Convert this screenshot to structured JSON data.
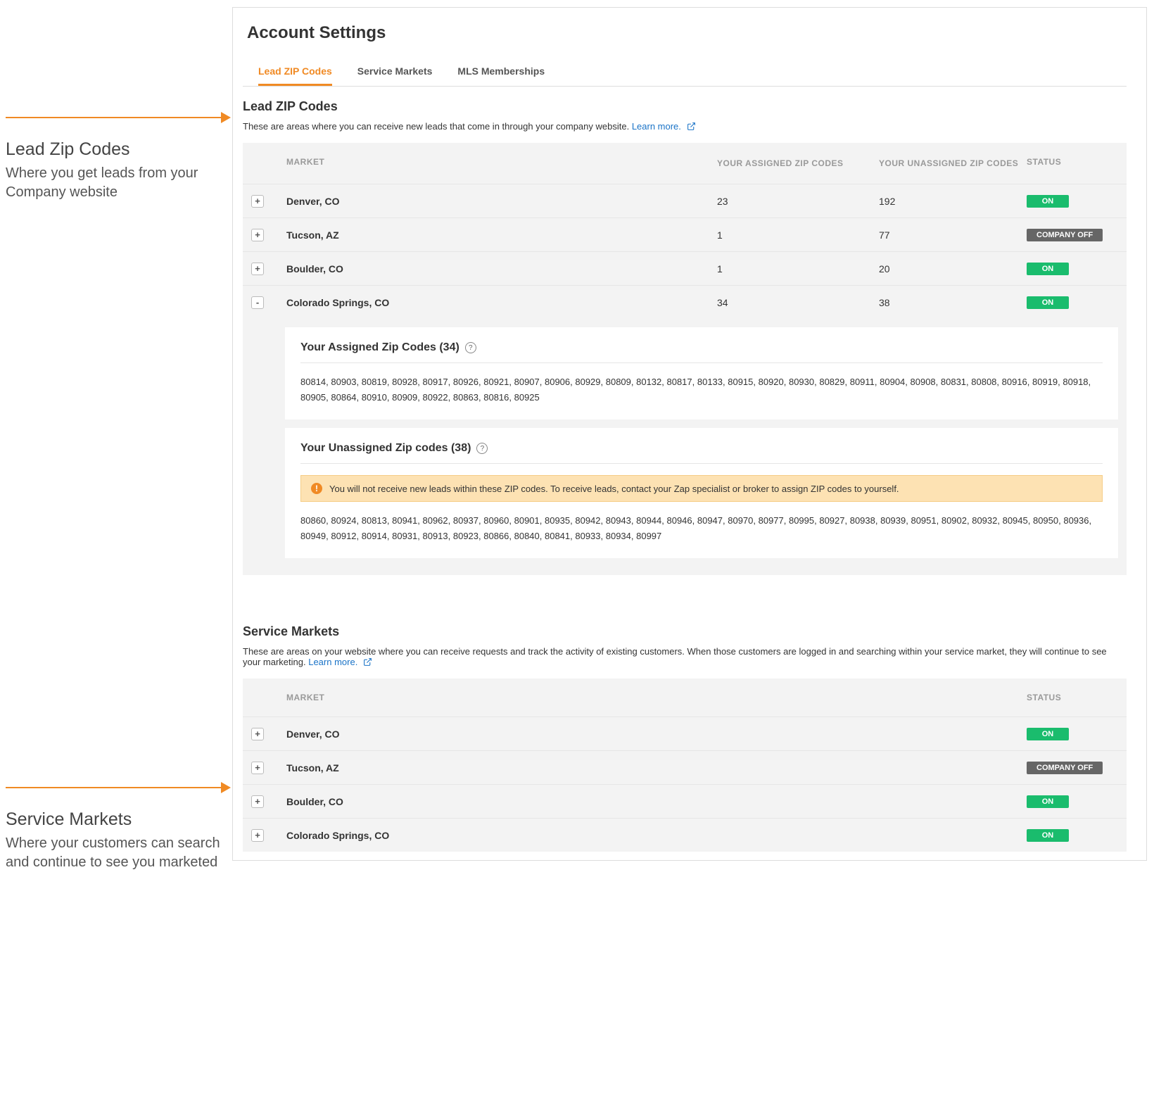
{
  "page_title": "Account Settings",
  "tabs": [
    {
      "label": "Lead ZIP Codes",
      "active": true
    },
    {
      "label": "Service Markets",
      "active": false
    },
    {
      "label": "MLS Memberships",
      "active": false
    }
  ],
  "lead_section": {
    "title": "Lead ZIP Codes",
    "description": "These are areas where you can receive new leads that come in through your company website.",
    "learn_more": "Learn more.",
    "columns": {
      "market": "MARKET",
      "assigned": "YOUR ASSIGNED ZIP CODES",
      "unassigned": "YOUR UNASSIGNED ZIP CODES",
      "status": "STATUS"
    },
    "rows": [
      {
        "market": "Denver, CO",
        "assigned": "23",
        "unassigned": "192",
        "status": "ON",
        "status_class": "on",
        "expanded": false
      },
      {
        "market": "Tucson, AZ",
        "assigned": "1",
        "unassigned": "77",
        "status": "COMPANY OFF",
        "status_class": "off",
        "expanded": false
      },
      {
        "market": "Boulder, CO",
        "assigned": "1",
        "unassigned": "20",
        "status": "ON",
        "status_class": "on",
        "expanded": false
      },
      {
        "market": "Colorado Springs, CO",
        "assigned": "34",
        "unassigned": "38",
        "status": "ON",
        "status_class": "on",
        "expanded": true
      }
    ],
    "expanded_detail": {
      "assigned_title": "Your Assigned Zip Codes (34)",
      "assigned_list": "80814, 80903, 80819, 80928, 80917, 80926, 80921, 80907, 80906, 80929, 80809, 80132, 80817, 80133, 80915, 80920, 80930, 80829, 80911, 80904, 80908, 80831, 80808, 80916, 80919, 80918, 80905, 80864, 80910, 80909, 80922, 80863, 80816, 80925",
      "unassigned_title": "Your Unassigned Zip codes (38)",
      "alert": "You will not receive new leads within these ZIP codes. To receive leads, contact your Zap specialist or broker to assign ZIP codes to yourself.",
      "unassigned_list": "80860, 80924, 80813, 80941, 80962, 80937, 80960, 80901, 80935, 80942, 80943, 80944, 80946, 80947, 80970, 80977, 80995, 80927, 80938, 80939, 80951, 80902, 80932, 80945, 80950, 80936, 80949, 80912, 80914, 80931, 80913, 80923, 80866, 80840, 80841, 80933, 80934, 80997"
    }
  },
  "service_section": {
    "title": "Service Markets",
    "description": "These are areas on your website where you can receive requests and track the activity of existing customers. When those customers are logged in and searching within your service market, they will continue to see your marketing.",
    "learn_more": "Learn more.",
    "columns": {
      "market": "MARKET",
      "status": "STATUS"
    },
    "rows": [
      {
        "market": "Denver, CO",
        "status": "ON",
        "status_class": "on"
      },
      {
        "market": "Tucson, AZ",
        "status": "COMPANY OFF",
        "status_class": "off"
      },
      {
        "market": "Boulder, CO",
        "status": "ON",
        "status_class": "on"
      },
      {
        "market": "Colorado Springs, CO",
        "status": "ON",
        "status_class": "on"
      }
    ]
  },
  "annotations": {
    "lead": {
      "title": "Lead Zip Codes",
      "text": "Where you get leads from your Company website"
    },
    "service": {
      "title": "Service Markets",
      "text": "Where your customers can search and continue to see you marketed"
    }
  },
  "glyphs": {
    "plus": "+",
    "minus": "-",
    "help": "?",
    "bang": "!"
  }
}
